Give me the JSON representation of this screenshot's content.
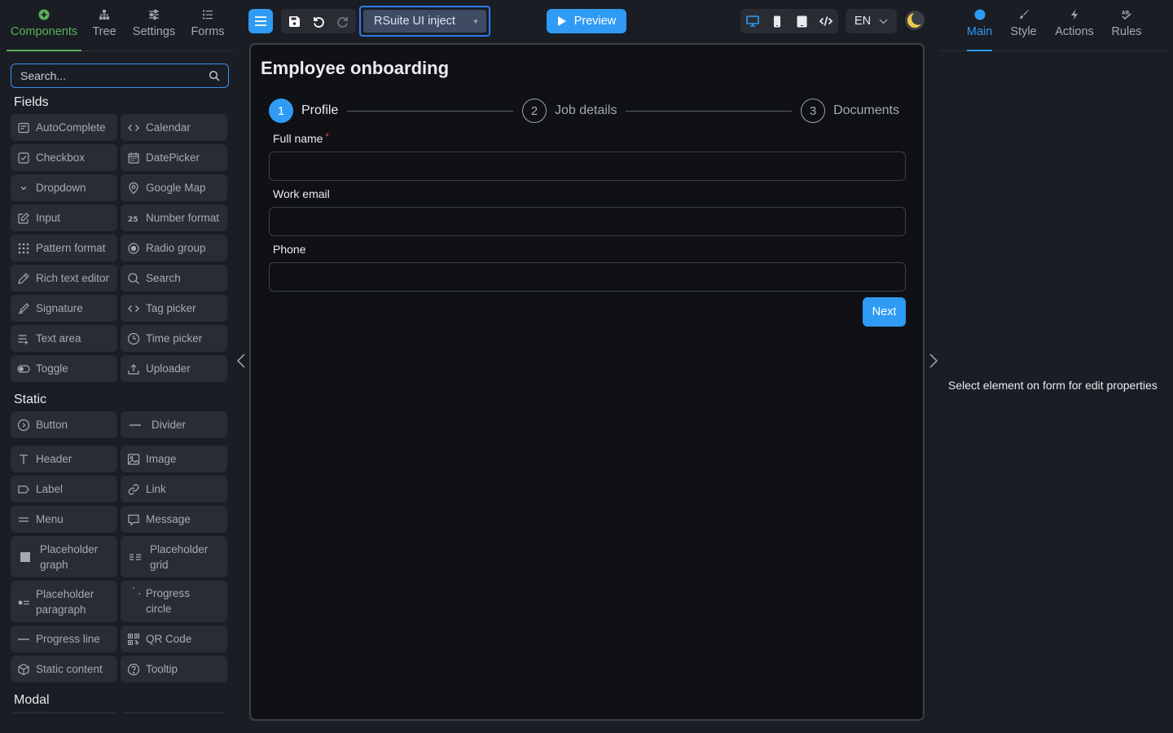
{
  "left_panel": {
    "tabs": [
      {
        "label": "Components",
        "icon": "plus-circle-icon"
      },
      {
        "label": "Tree",
        "icon": "tree-icon"
      },
      {
        "label": "Settings",
        "icon": "sliders-icon"
      },
      {
        "label": "Forms",
        "icon": "list-icon"
      }
    ],
    "search_placeholder": "Search...",
    "sections": {
      "fields": {
        "title": "Fields",
        "items": [
          "AutoComplete",
          "Calendar",
          "Checkbox",
          "DatePicker",
          "Dropdown",
          "Google Map",
          "Input",
          "Number format",
          "Pattern format",
          "Radio group",
          "Rich text editor",
          "Search",
          "Signature",
          "Tag picker",
          "Text area",
          "Time picker",
          "Toggle",
          "Uploader"
        ]
      },
      "static": {
        "title": "Static",
        "items": [
          "Button",
          "Divider",
          "Header",
          "Image",
          "Label",
          "Link",
          "Menu",
          "Message",
          "Placeholder graph",
          "Placeholder grid",
          "Placeholder paragraph",
          "Progress circle",
          "Progress line",
          "QR Code",
          "Static content",
          "Tooltip"
        ]
      },
      "modal": {
        "title": "Modal"
      }
    }
  },
  "toolbar": {
    "form_name": "RSuite UI inject",
    "preview_label": "Preview",
    "language": "EN"
  },
  "form": {
    "title": "Employee onboarding",
    "steps": [
      {
        "number": "1",
        "label": "Profile",
        "state": "active"
      },
      {
        "number": "2",
        "label": "Job details",
        "state": "todo"
      },
      {
        "number": "3",
        "label": "Documents",
        "state": "todo"
      }
    ],
    "fields": [
      {
        "label": "Full name",
        "required_mark": "*",
        "value": ""
      },
      {
        "label": "Work email",
        "value": ""
      },
      {
        "label": "Phone",
        "value": ""
      }
    ],
    "next_label": "Next"
  },
  "right_panel": {
    "tabs": [
      {
        "label": "Main",
        "icon": "dot-icon"
      },
      {
        "label": "Style",
        "icon": "brush-icon"
      },
      {
        "label": "Actions",
        "icon": "bolt-icon"
      },
      {
        "label": "Rules",
        "icon": "rules-icon"
      }
    ],
    "hint": "Select element on form for edit properties"
  },
  "colors": {
    "accent": "#2f9bf4",
    "components_tab": "#58b15b",
    "background": "#1a1d24",
    "canvas": "#0f1115",
    "tile": "#292d33",
    "required": "#f04f43"
  }
}
